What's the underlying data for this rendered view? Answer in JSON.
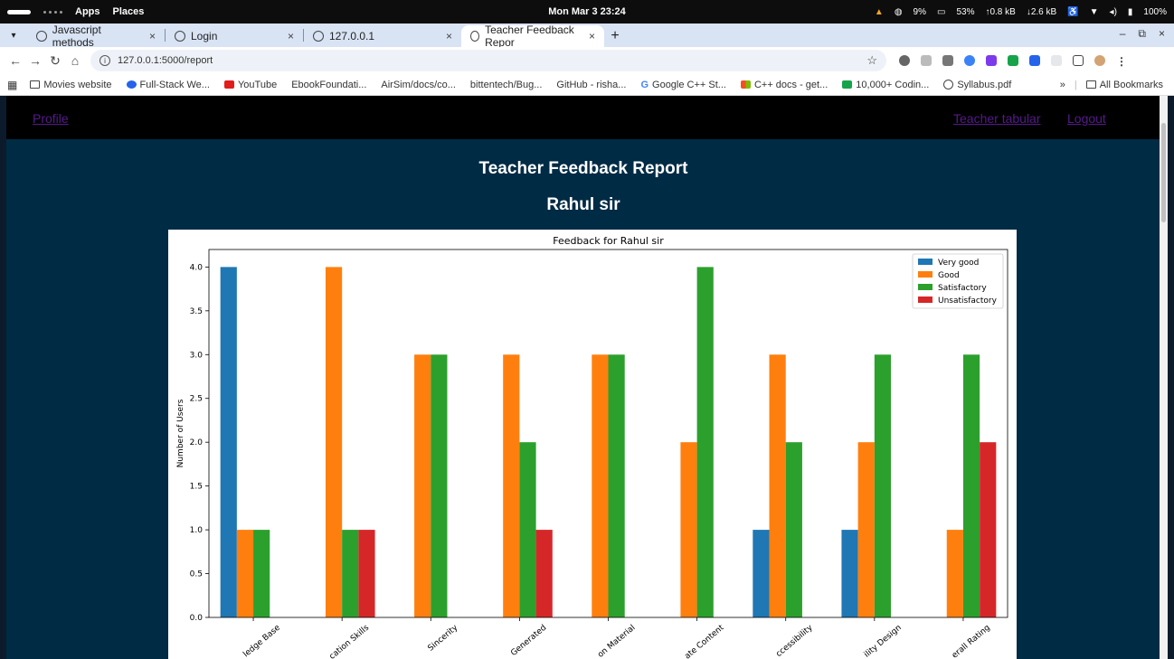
{
  "os": {
    "apps": "Apps",
    "places": "Places",
    "clock": "Mon Mar 3  23:24",
    "cpu": "9%",
    "mem": "53%",
    "up": "↑0.8 kB",
    "down": "↓2.6 kB",
    "battery": "100%"
  },
  "tabs": [
    {
      "label": "Javascript methods",
      "active": false
    },
    {
      "label": "Login",
      "active": false
    },
    {
      "label": "127.0.0.1",
      "active": false
    },
    {
      "label": "Teacher Feedback Repor",
      "active": true
    }
  ],
  "address": {
    "url": "127.0.0.1:5000/report"
  },
  "bookmarks": [
    "Movies website",
    "Full-Stack We...",
    "YouTube",
    "EbookFoundati...",
    "AirSim/docs/co...",
    "bittentech/Bug...",
    "GitHub - risha...",
    "Google C++ St...",
    "C++ docs - get...",
    "10,000+ Codin...",
    "Syllabus.pdf"
  ],
  "bookmarks_more": "»",
  "all_bookmarks": "All Bookmarks",
  "nav": {
    "profile": "Profile",
    "teacher_tabular": "Teacher tabular",
    "logout": "Logout"
  },
  "page": {
    "title": "Teacher Feedback Report",
    "teacher": "Rahul sir"
  },
  "colors": {
    "nav_bg": "#000000",
    "page_bg": "#002b45",
    "link": "#551a8b"
  },
  "chart_data": {
    "type": "bar",
    "title": "Feedback for Rahul sir",
    "xlabel": "",
    "ylabel": "Number of Users",
    "ylim": [
      0,
      4.2
    ],
    "yticks": [
      "0.0",
      "0.5",
      "1.0",
      "1.5",
      "2.0",
      "2.5",
      "3.0",
      "3.5",
      "4.0"
    ],
    "categories": [
      "Knowledge Base",
      "Communication Skills",
      "Sincerity",
      "Interest Generated",
      "Presentation Material",
      "Appropriate Content",
      "Accessibility",
      "Ability Design",
      "Overall Rating"
    ],
    "visible_tick_labels": [
      "ledge Base",
      "cation Skills",
      "Sincerity",
      "Generated",
      "on Material",
      "ate Content",
      "ccessibility",
      "ility Design",
      "erall Rating"
    ],
    "legend_position": "top-right",
    "series": [
      {
        "name": "Very good",
        "color": "#1f77b4",
        "values": [
          4,
          0,
          0,
          0,
          0,
          0,
          1,
          1,
          0
        ]
      },
      {
        "name": "Good",
        "color": "#ff7f0e",
        "values": [
          1,
          4,
          3,
          3,
          3,
          2,
          3,
          2,
          1
        ]
      },
      {
        "name": "Satisfactory",
        "color": "#2ca02c",
        "values": [
          1,
          1,
          3,
          2,
          3,
          4,
          2,
          3,
          3
        ]
      },
      {
        "name": "Unsatisfactory",
        "color": "#d62728",
        "values": [
          0,
          1,
          0,
          1,
          0,
          0,
          0,
          0,
          2
        ]
      }
    ]
  }
}
